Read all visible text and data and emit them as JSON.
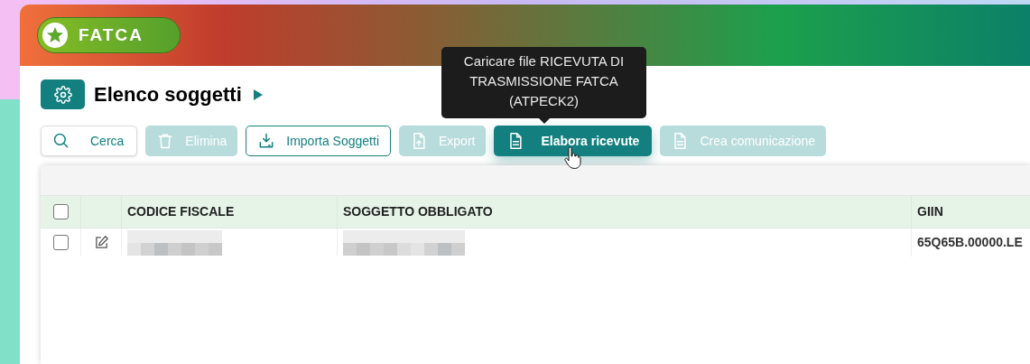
{
  "app": {
    "name": "FATCA"
  },
  "page": {
    "title": "Elenco soggetti"
  },
  "toolbar": [
    {
      "label": "Cerca",
      "disabled": false
    },
    {
      "label": "Elimina",
      "disabled": true
    },
    {
      "label": "Importa Soggetti",
      "disabled": false
    },
    {
      "label": "Export",
      "disabled": true
    },
    {
      "label": "Elabora ricevute",
      "disabled": false
    },
    {
      "label": "Crea comunicazione",
      "disabled": true
    }
  ],
  "tooltip": {
    "text": "Caricare file RICEVUTA DI TRASMISSIONE FATCA (ATPECK2)"
  },
  "table": {
    "select_all": {
      "checked": false
    },
    "columns": [
      "CODICE FISCALE",
      "SOGGETTO OBBLIGATO",
      "GIIN"
    ],
    "rows": [
      {
        "checked": false,
        "cells": [
          {
            "kind": "redacted"
          },
          {
            "kind": "redacted"
          },
          {
            "kind": "text",
            "text": "65Q65B.00000.LE"
          }
        ]
      }
    ]
  }
}
